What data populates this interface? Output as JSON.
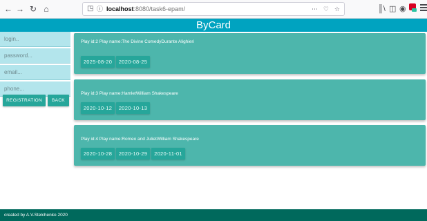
{
  "browser": {
    "url_host": "localhost",
    "url_rest": ":8080/task6-epam/",
    "page_actions": "⋯"
  },
  "header": {
    "title": "ByCard"
  },
  "form": {
    "login_placeholder": "login..",
    "password_placeholder": "password...",
    "email_placeholder": "email...",
    "phone_placeholder": "phone...",
    "registration_label": "REGISTRATION",
    "back_label": "BACK"
  },
  "plays": [
    {
      "title": "Play id:2 Play name:The Divine ComedyDurante Alighieri",
      "dates": [
        "2025-08-20",
        "2020-08-25"
      ]
    },
    {
      "title": "Play id:3 Play name:HamletWilliam Shakespeare",
      "dates": [
        "2020-10-12",
        "2020-10-13"
      ]
    },
    {
      "title": "Play id:4 Play name:Romeo and JulietWilliam Shakespeare",
      "dates": [
        "2020-10-28",
        "2020-10-29",
        "2020-11-01"
      ]
    }
  ],
  "footer": {
    "text": "created by A.V.Stelchenko 2020"
  },
  "colors": {
    "header_bg": "#00a3c0",
    "card_bg": "#4db6ac",
    "chip_bg": "#26a69a",
    "field_bg": "#b3e5ec",
    "footer_bg": "#00695c"
  }
}
